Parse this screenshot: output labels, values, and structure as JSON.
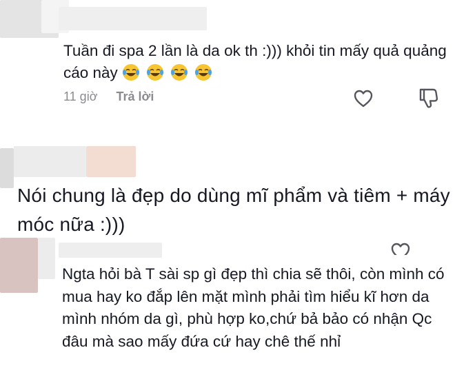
{
  "comments": [
    {
      "text": "Tuần đi spa 2 lần là da ok th :))) khỏi tin mấy quả quảng cáo này",
      "emojis": [
        "tears-of-joy-emoji",
        "tears-of-joy-emoji",
        "tears-of-joy-emoji",
        "tears-of-joy-emoji"
      ],
      "time": "11 giờ",
      "reply_label": "Trả lời",
      "like_icon": "heart-outline-icon",
      "dislike_icon": "thumbs-down-icon"
    },
    {
      "text": "Nói chung là đẹp do dùng mĩ phẩm và tiêm + máy móc nữa :)))"
    },
    {
      "text": "Ngta hỏi bà T sài sp gì đẹp thì chia sẽ thôi, còn mình có mua hay ko đắp lên mặt mình phải tìm hiểu kĩ hơn da mình nhóm da gì, phù hợp ko,chứ bả bảo có nhận Qc đâu mà sao mấy đứa cứ hay chê thế nhỉ",
      "like_icon": "heart-outline-icon"
    }
  ],
  "colors": {
    "text": "#161823",
    "meta": "#8a8b91",
    "emoji_face": "#f7c531"
  }
}
